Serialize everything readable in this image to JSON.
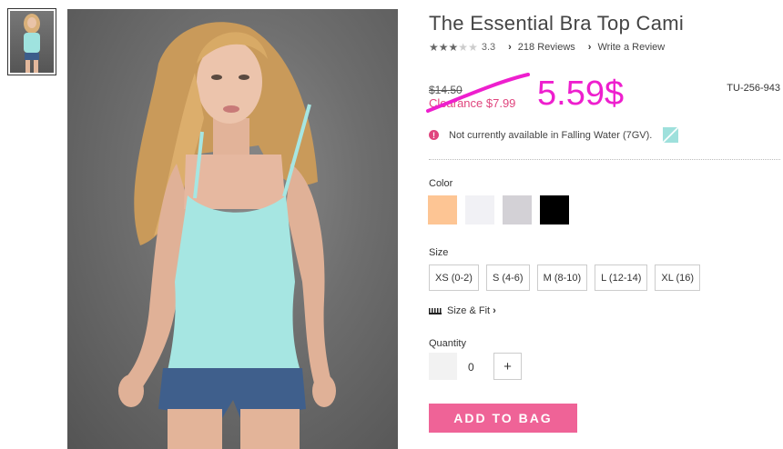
{
  "product": {
    "title": "The Essential Bra Top Cami",
    "rating_value": "3.3",
    "rating_stars": 3.3,
    "reviews_link": "218 Reviews",
    "write_review_link": "Write a Review",
    "original_price": "$14.50",
    "clearance_price": "Clearance $7.99",
    "handwritten_price": "5.59$",
    "sku": "TU-256-943",
    "availability": "Not currently available in Falling Water (7GV).",
    "availability_icon": "!"
  },
  "options": {
    "color_label": "Color",
    "colors": [
      "#fdc594",
      "#f1f1f5",
      "#d3d1d6",
      "#000000"
    ],
    "size_label": "Size",
    "sizes": [
      "XS (0-2)",
      "S (4-6)",
      "M (8-10)",
      "L (12-14)",
      "XL (16)"
    ],
    "size_fit_link": "Size & Fit",
    "quantity_label": "Quantity",
    "quantity_value": "0",
    "plus_symbol": "+"
  },
  "actions": {
    "add_to_bag": "ADD TO BAG"
  },
  "icons": {
    "heart": "heart-icon",
    "chevron": "›",
    "ruler": "ruler-icon",
    "alert": "alert-icon"
  },
  "colors": {
    "accent_pink": "#ef6397",
    "clearance_pink": "#e0457e",
    "annotation_magenta": "#ee1fce"
  }
}
